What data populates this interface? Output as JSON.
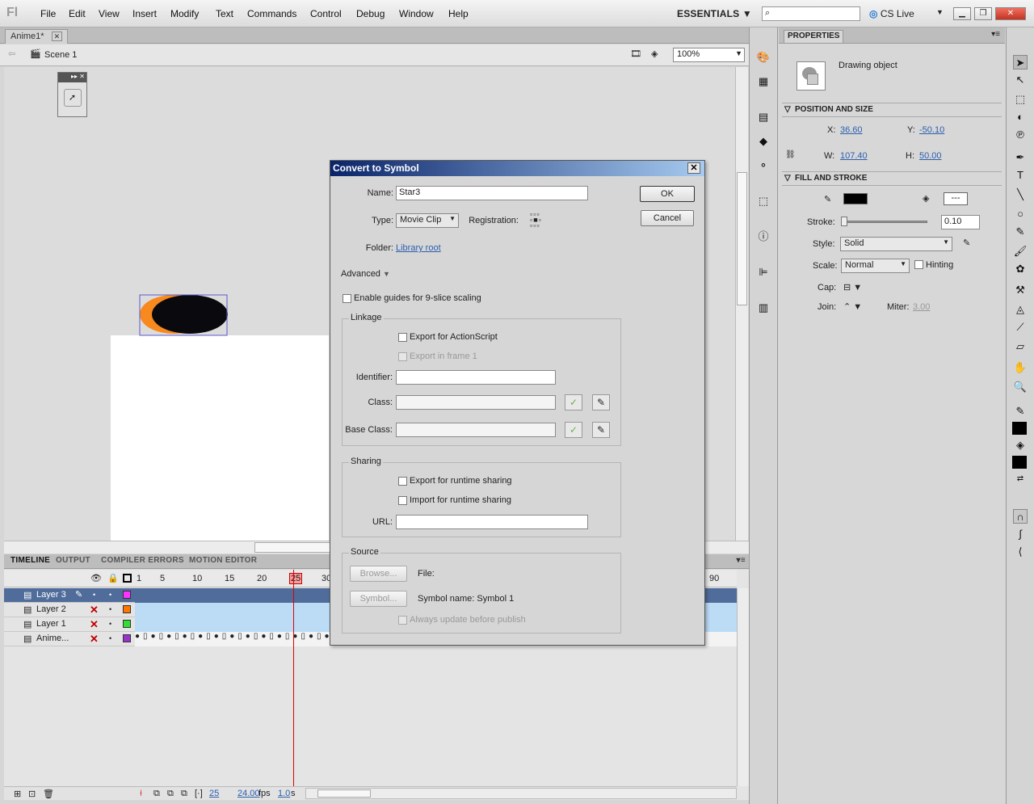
{
  "menubar": {
    "logo": "Fl",
    "items": [
      "File",
      "Edit",
      "View",
      "Insert",
      "Modify",
      "Text",
      "Commands",
      "Control",
      "Debug",
      "Window",
      "Help"
    ],
    "workspace": "ESSENTIALS",
    "search_value": "",
    "cs_live": "CS Live"
  },
  "document": {
    "tab": "Anime1*",
    "scene": "Scene 1",
    "zoom": "100%"
  },
  "timeline": {
    "tabs": [
      "TIMELINE",
      "OUTPUT",
      "COMPILER ERRORS",
      "MOTION EDITOR"
    ],
    "ruler": [
      "1",
      "5",
      "10",
      "15",
      "20",
      "25",
      "30",
      "90"
    ],
    "layers": [
      {
        "name": "Layer 3",
        "color": "#ff33ff"
      },
      {
        "name": "Layer 2",
        "color": "#ff7700"
      },
      {
        "name": "Layer 1",
        "color": "#33dd33"
      },
      {
        "name": "Anime...",
        "color": "#9933cc"
      }
    ],
    "status": {
      "frame": "25",
      "fps": "24.00",
      "fps_unit": "fps",
      "time": "1.0",
      "time_unit": "s"
    }
  },
  "properties": {
    "tab": "PROPERTIES",
    "object_type": "Drawing object",
    "position_section": "POSITION AND SIZE",
    "x_label": "X:",
    "x": "36.60",
    "y_label": "Y:",
    "y": "-50.10",
    "w_label": "W:",
    "w": "107.40",
    "h_label": "H:",
    "h": "50.00",
    "fill_section": "FILL AND STROKE",
    "stroke_label": "Stroke:",
    "stroke": "0.10",
    "style_label": "Style:",
    "style": "Solid",
    "scale_label": "Scale:",
    "scale": "Normal",
    "hinting": "Hinting",
    "cap_label": "Cap:",
    "join_label": "Join:",
    "miter_label": "Miter:",
    "miter": "3.00"
  },
  "dialog": {
    "title": "Convert to Symbol",
    "name_label": "Name:",
    "name_value": "Star3",
    "type_label": "Type:",
    "type_value": "Movie Clip",
    "registration_label": "Registration:",
    "folder_label": "Folder:",
    "folder_value": "Library root",
    "ok": "OK",
    "cancel": "Cancel",
    "advanced": "Advanced",
    "nine_slice": "Enable guides for 9-slice scaling",
    "linkage": "Linkage",
    "export_as": "Export for ActionScript",
    "export_frame1": "Export in frame 1",
    "identifier_label": "Identifier:",
    "class_label": "Class:",
    "base_class_label": "Base Class:",
    "sharing": "Sharing",
    "export_runtime": "Export for runtime sharing",
    "import_runtime": "Import for runtime sharing",
    "url_label": "URL:",
    "source": "Source",
    "browse": "Browse...",
    "file_label": "File:",
    "symbol_btn": "Symbol...",
    "symbol_name": "Symbol name: Symbol 1",
    "always_update": "Always update before publish"
  }
}
